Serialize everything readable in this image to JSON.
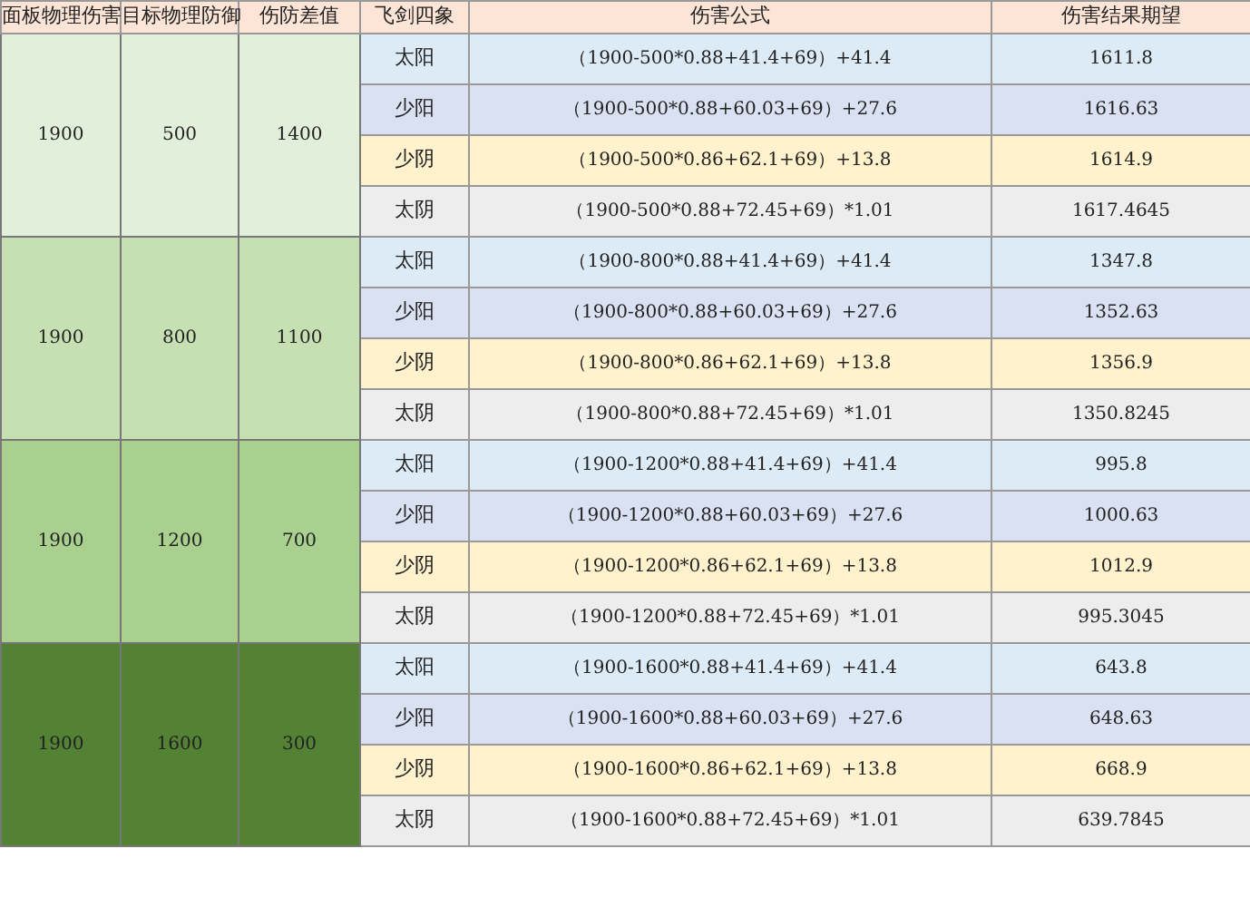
{
  "table": {
    "columns": [
      "面板物理伤害",
      "目标物理防御",
      "伤防差值",
      "飞剑四象",
      "伤害公式",
      "伤害结果期望"
    ],
    "groups": [
      {
        "panel": "1900",
        "defense": "500",
        "diff": "1400",
        "color": "#e2efda",
        "rows": [
          {
            "symbol": "太阳",
            "formula": "（1900-500*0.88+41.4+69）+41.4",
            "result": "1611.8",
            "color": "#ddebf7"
          },
          {
            "symbol": "少阳",
            "formula": "（1900-500*0.88+60.03+69）+27.6",
            "result": "1616.63",
            "color": "#d9e1f2"
          },
          {
            "symbol": "少阴",
            "formula": "（1900-500*0.86+62.1+69）+13.8",
            "result": "1614.9",
            "color": "#fff2cc"
          },
          {
            "symbol": "太阴",
            "formula": "（1900-500*0.88+72.45+69）*1.01",
            "result": "1617.4645",
            "color": "#ededed"
          }
        ]
      },
      {
        "panel": "1900",
        "defense": "800",
        "diff": "1100",
        "color": "#c6e0b4",
        "rows": [
          {
            "symbol": "太阳",
            "formula": "（1900-800*0.88+41.4+69）+41.4",
            "result": "1347.8",
            "color": "#ddebf7"
          },
          {
            "symbol": "少阳",
            "formula": "（1900-800*0.88+60.03+69）+27.6",
            "result": "1352.63",
            "color": "#d9e1f2"
          },
          {
            "symbol": "少阴",
            "formula": "（1900-800*0.86+62.1+69）+13.8",
            "result": "1356.9",
            "color": "#fff2cc"
          },
          {
            "symbol": "太阴",
            "formula": "（1900-800*0.88+72.45+69）*1.01",
            "result": "1350.8245",
            "color": "#ededed"
          }
        ]
      },
      {
        "panel": "1900",
        "defense": "1200",
        "diff": "700",
        "color": "#a9d08e",
        "rows": [
          {
            "symbol": "太阳",
            "formula": "（1900-1200*0.88+41.4+69）+41.4",
            "result": "995.8",
            "color": "#ddebf7"
          },
          {
            "symbol": "少阳",
            "formula": "（1900-1200*0.88+60.03+69）+27.6",
            "result": "1000.63",
            "color": "#d9e1f2"
          },
          {
            "symbol": "少阴",
            "formula": "（1900-1200*0.86+62.1+69）+13.8",
            "result": "1012.9",
            "color": "#fff2cc"
          },
          {
            "symbol": "太阴",
            "formula": "（1900-1200*0.88+72.45+69）*1.01",
            "result": "995.3045",
            "color": "#ededed"
          }
        ]
      },
      {
        "panel": "1900",
        "defense": "1600",
        "diff": "300",
        "color": "#548235",
        "rows": [
          {
            "symbol": "太阳",
            "formula": "（1900-1600*0.88+41.4+69）+41.4",
            "result": "643.8",
            "color": "#ddebf7"
          },
          {
            "symbol": "少阳",
            "formula": "（1900-1600*0.88+60.03+69）+27.6",
            "result": "648.63",
            "color": "#d9e1f2"
          },
          {
            "symbol": "少阴",
            "formula": "（1900-1600*0.86+62.1+69）+13.8",
            "result": "668.9",
            "color": "#fff2cc"
          },
          {
            "symbol": "太阴",
            "formula": "（1900-1600*0.88+72.45+69）*1.01",
            "result": "639.7845",
            "color": "#ededed"
          }
        ]
      }
    ]
  }
}
